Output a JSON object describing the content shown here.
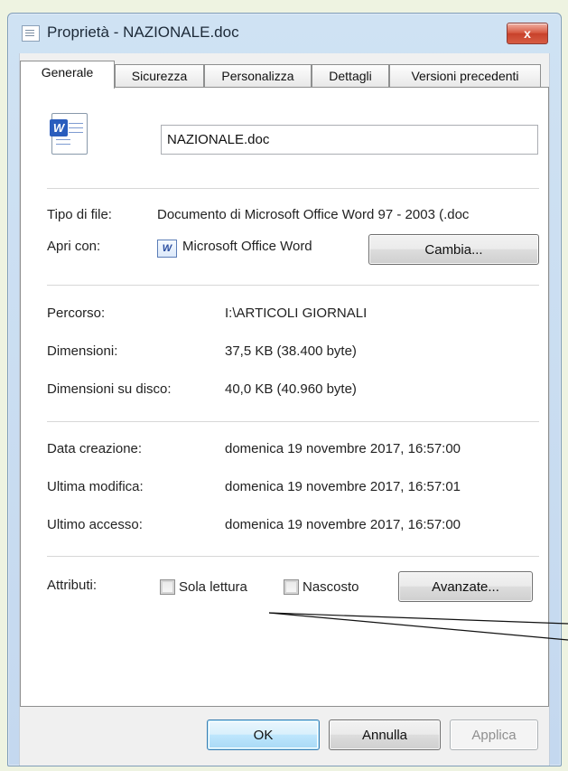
{
  "window": {
    "title": "Proprietà - NAZIONALE.doc",
    "close_glyph": "x"
  },
  "tabs": [
    {
      "label": "Generale",
      "active": true
    },
    {
      "label": "Sicurezza",
      "active": false
    },
    {
      "label": "Personalizza",
      "active": false
    },
    {
      "label": "Dettagli",
      "active": false
    },
    {
      "label": "Versioni precedenti",
      "active": false
    }
  ],
  "general": {
    "file_name": "NAZIONALE.doc",
    "type_label": "Tipo di file:",
    "type_value": "Documento di Microsoft Office Word 97 - 2003 (.doc",
    "open_with_label": "Apri con:",
    "open_with_value": "Microsoft Office Word",
    "change_button": "Cambia...",
    "path_label": "Percorso:",
    "path_value": "I:\\ARTICOLI GIORNALI",
    "size_label": "Dimensioni:",
    "size_value": "37,5 KB (38.400 byte)",
    "disk_size_label": "Dimensioni su disco:",
    "disk_size_value": "40,0 KB (40.960 byte)",
    "created_label": "Data creazione:",
    "created_value": "domenica 19 novembre 2017, 16:57:00",
    "modified_label": "Ultima modifica:",
    "modified_value": "domenica 19 novembre 2017, 16:57:01",
    "accessed_label": "Ultimo accesso:",
    "accessed_value": "domenica 19 novembre 2017, 16:57:00",
    "attributes_label": "Attributi:",
    "readonly_label": "Sola lettura",
    "readonly_checked": false,
    "hidden_label": "Nascosto",
    "hidden_checked": false,
    "advanced_button": "Avanzate..."
  },
  "footer": {
    "ok": "OK",
    "cancel": "Annulla",
    "apply": "Applica",
    "apply_enabled": false
  },
  "colors": {
    "background": "#eef3e1",
    "window_frame": "#c4d8ef",
    "close_button": "#c7412b",
    "default_button": "#bee6fd"
  }
}
